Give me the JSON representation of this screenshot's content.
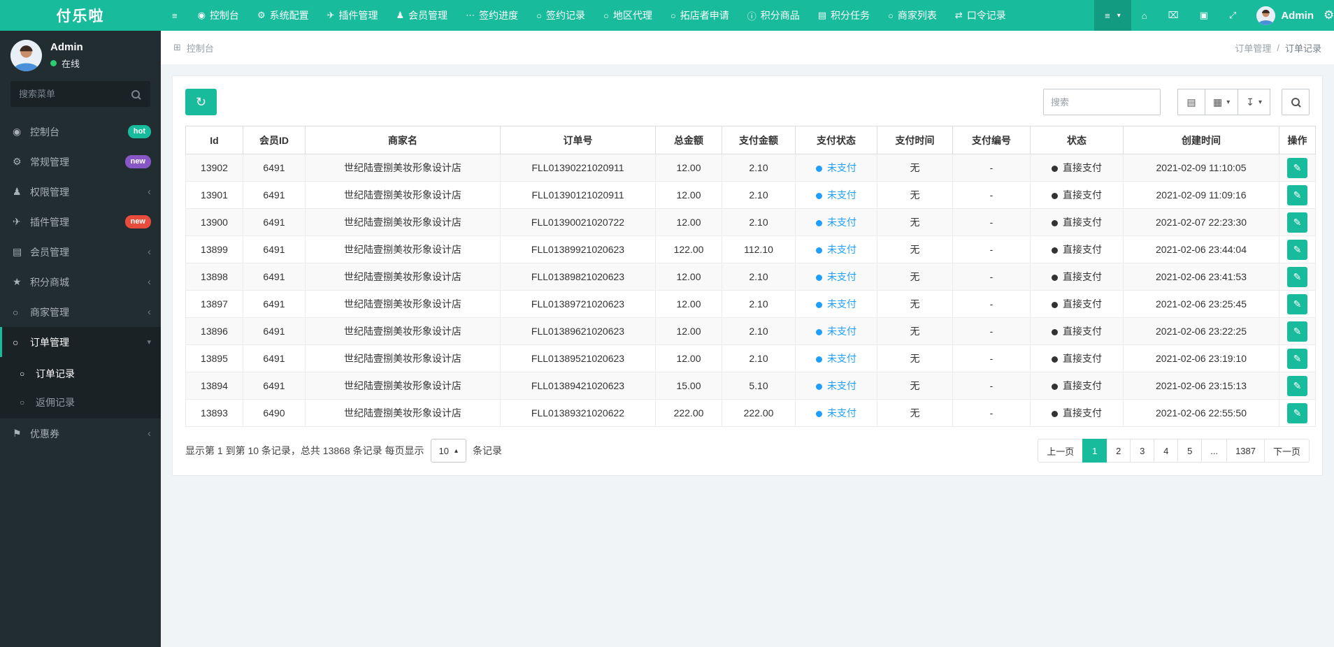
{
  "accent": "#18bc9c",
  "brand": "付乐啦",
  "topnav": {
    "items": [
      {
        "name": "console",
        "icon": "dashboard",
        "label": "控制台"
      },
      {
        "name": "system-config",
        "icon": "gear",
        "label": "系统配置"
      },
      {
        "name": "plugin-manage",
        "icon": "plane",
        "label": "插件管理"
      },
      {
        "name": "member-manage",
        "icon": "user",
        "label": "会员管理"
      },
      {
        "name": "sign-progress",
        "icon": "ellipsis",
        "label": "签约进度"
      },
      {
        "name": "sign-records",
        "icon": "circle",
        "label": "签约记录"
      },
      {
        "name": "region-agent",
        "icon": "circle",
        "label": "地区代理"
      },
      {
        "name": "store-apply",
        "icon": "circle",
        "label": "拓店者申请"
      },
      {
        "name": "points-goods",
        "icon": "info",
        "label": "积分商品"
      },
      {
        "name": "points-tasks",
        "icon": "list",
        "label": "积分任务"
      },
      {
        "name": "merchant-list",
        "icon": "circle",
        "label": "商家列表"
      },
      {
        "name": "token-records",
        "icon": "shuffle",
        "label": "口令记录"
      }
    ],
    "right_items": [
      {
        "name": "style-switch-button",
        "icon": "menu",
        "caret": true,
        "active": true
      },
      {
        "name": "home-button",
        "icon": "home"
      },
      {
        "name": "clear-cache-button",
        "icon": "trash"
      },
      {
        "name": "shop-button",
        "icon": "shop"
      },
      {
        "name": "fullscreen-button",
        "icon": "fullscreen"
      }
    ],
    "user": {
      "name": "Admin"
    }
  },
  "sidebar": {
    "user": {
      "name": "Admin",
      "status": "在线"
    },
    "search_placeholder": "搜索菜单",
    "items": [
      {
        "name": "console",
        "icon": "dashboard",
        "label": "控制台",
        "badge": {
          "text": "hot",
          "color": "#18bc9c"
        }
      },
      {
        "name": "general-manage",
        "icon": "gear",
        "label": "常规管理",
        "badge": {
          "text": "new",
          "color": "#8757c7"
        }
      },
      {
        "name": "auth-manage",
        "icon": "users",
        "label": "权限管理",
        "chevron": true
      },
      {
        "name": "addon-manage",
        "icon": "plane",
        "label": "插件管理",
        "badge": {
          "text": "new",
          "color": "#e74c3c"
        }
      },
      {
        "name": "member-manage",
        "icon": "list",
        "label": "会员管理",
        "chevron": true
      },
      {
        "name": "points-mall",
        "icon": "star",
        "label": "积分商城",
        "chevron": true
      },
      {
        "name": "merchant-manage",
        "icon": "circle",
        "label": "商家管理",
        "chevron": true
      },
      {
        "name": "order-manage",
        "icon": "circle",
        "label": "订单管理",
        "active": true,
        "children": [
          {
            "name": "order-records",
            "label": "订单记录",
            "active": true
          },
          {
            "name": "rebate-records",
            "label": "返佣记录"
          }
        ]
      },
      {
        "name": "coupon",
        "icon": "flag",
        "label": "优惠券",
        "chevron": true
      }
    ]
  },
  "breadcrumb": {
    "section": "控制台",
    "parent": "订单管理",
    "separator": "/",
    "current": "订单记录"
  },
  "toolbar": {
    "search_placeholder": "搜索"
  },
  "table": {
    "columns": [
      "Id",
      "会员ID",
      "商家名",
      "订单号",
      "总金额",
      "支付金额",
      "支付状态",
      "支付时间",
      "支付编号",
      "状态",
      "创建时间",
      "操作"
    ],
    "pay_status_color": "#1e9fff",
    "rows": [
      {
        "id": "13902",
        "member_id": "6491",
        "merchant": "世纪陆壹捌美妆形象设计店",
        "order_no": "FLL01390221020911",
        "total": "12.00",
        "paid": "2.10",
        "pay_status": "未支付",
        "pay_time": "无",
        "pay_no": "-",
        "status": "直接支付",
        "created": "2021-02-09 11:10:05"
      },
      {
        "id": "13901",
        "member_id": "6491",
        "merchant": "世纪陆壹捌美妆形象设计店",
        "order_no": "FLL01390121020911",
        "total": "12.00",
        "paid": "2.10",
        "pay_status": "未支付",
        "pay_time": "无",
        "pay_no": "-",
        "status": "直接支付",
        "created": "2021-02-09 11:09:16"
      },
      {
        "id": "13900",
        "member_id": "6491",
        "merchant": "世纪陆壹捌美妆形象设计店",
        "order_no": "FLL01390021020722",
        "total": "12.00",
        "paid": "2.10",
        "pay_status": "未支付",
        "pay_time": "无",
        "pay_no": "-",
        "status": "直接支付",
        "created": "2021-02-07 22:23:30"
      },
      {
        "id": "13899",
        "member_id": "6491",
        "merchant": "世纪陆壹捌美妆形象设计店",
        "order_no": "FLL01389921020623",
        "total": "122.00",
        "paid": "112.10",
        "pay_status": "未支付",
        "pay_time": "无",
        "pay_no": "-",
        "status": "直接支付",
        "created": "2021-02-06 23:44:04"
      },
      {
        "id": "13898",
        "member_id": "6491",
        "merchant": "世纪陆壹捌美妆形象设计店",
        "order_no": "FLL01389821020623",
        "total": "12.00",
        "paid": "2.10",
        "pay_status": "未支付",
        "pay_time": "无",
        "pay_no": "-",
        "status": "直接支付",
        "created": "2021-02-06 23:41:53"
      },
      {
        "id": "13897",
        "member_id": "6491",
        "merchant": "世纪陆壹捌美妆形象设计店",
        "order_no": "FLL01389721020623",
        "total": "12.00",
        "paid": "2.10",
        "pay_status": "未支付",
        "pay_time": "无",
        "pay_no": "-",
        "status": "直接支付",
        "created": "2021-02-06 23:25:45"
      },
      {
        "id": "13896",
        "member_id": "6491",
        "merchant": "世纪陆壹捌美妆形象设计店",
        "order_no": "FLL01389621020623",
        "total": "12.00",
        "paid": "2.10",
        "pay_status": "未支付",
        "pay_time": "无",
        "pay_no": "-",
        "status": "直接支付",
        "created": "2021-02-06 23:22:25"
      },
      {
        "id": "13895",
        "member_id": "6491",
        "merchant": "世纪陆壹捌美妆形象设计店",
        "order_no": "FLL01389521020623",
        "total": "12.00",
        "paid": "2.10",
        "pay_status": "未支付",
        "pay_time": "无",
        "pay_no": "-",
        "status": "直接支付",
        "created": "2021-02-06 23:19:10"
      },
      {
        "id": "13894",
        "member_id": "6491",
        "merchant": "世纪陆壹捌美妆形象设计店",
        "order_no": "FLL01389421020623",
        "total": "15.00",
        "paid": "5.10",
        "pay_status": "未支付",
        "pay_time": "无",
        "pay_no": "-",
        "status": "直接支付",
        "created": "2021-02-06 23:15:13"
      },
      {
        "id": "13893",
        "member_id": "6490",
        "merchant": "世纪陆壹捌美妆形象设计店",
        "order_no": "FLL01389321020622",
        "total": "222.00",
        "paid": "222.00",
        "pay_status": "未支付",
        "pay_time": "无",
        "pay_no": "-",
        "status": "直接支付",
        "created": "2021-02-06 22:55:50"
      }
    ]
  },
  "footer": {
    "summary_prefix": "显示第 1 到第 10 条记录，总共 13868 条记录 每页显示",
    "page_size": "10",
    "summary_suffix": "条记录"
  },
  "pagination": {
    "prev": "上一页",
    "pages": [
      "1",
      "2",
      "3",
      "4",
      "5",
      "...",
      "1387"
    ],
    "active": "1",
    "next": "下一页"
  }
}
